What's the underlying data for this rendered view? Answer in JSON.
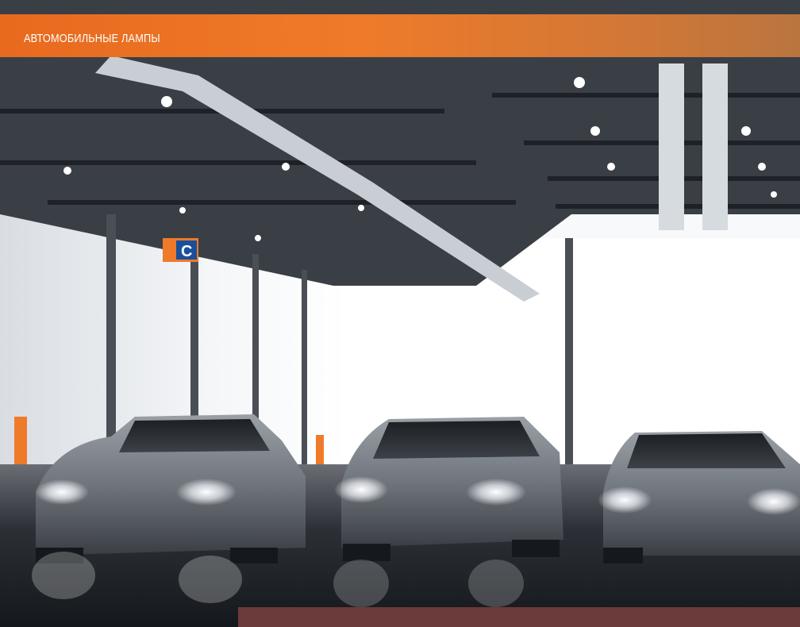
{
  "banner": {
    "title": "АВТОМОБИЛЬНЫЕ ЛАМПЫ"
  },
  "sign": {
    "letter": "C"
  },
  "photo": {
    "subject": "hangar-with-three-cars",
    "colors": {
      "accent": "#ef7a2a",
      "floor": "#1c1f24",
      "ceiling": "#2a2e35",
      "wall": "#e9ecef",
      "bottom_strip": "#6b3a3a"
    }
  }
}
